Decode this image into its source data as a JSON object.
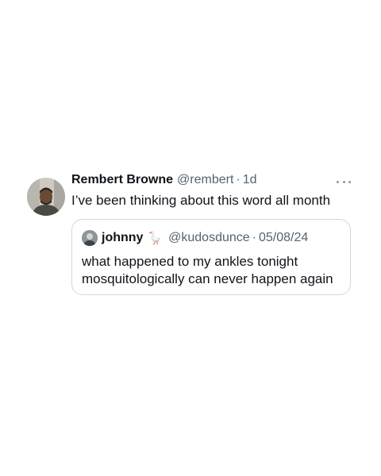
{
  "tweet": {
    "display_name": "Rembert Browne",
    "handle": "@rembert",
    "separator": "·",
    "time": "1d",
    "text": "I’ve been thinking about this word all month",
    "more_icon": "more-horizontal-icon"
  },
  "quoted_tweet": {
    "display_name": "johnny",
    "emoji": "🪿",
    "handle": "@kudosdunce",
    "separator": "·",
    "date": "05/08/24",
    "text_line1": "what happened to my ankles tonight",
    "text_line2": "mosquitologically can never happen again"
  },
  "colors": {
    "text_primary": "#0f1419",
    "text_secondary": "#536471",
    "border": "#cfd9de"
  }
}
